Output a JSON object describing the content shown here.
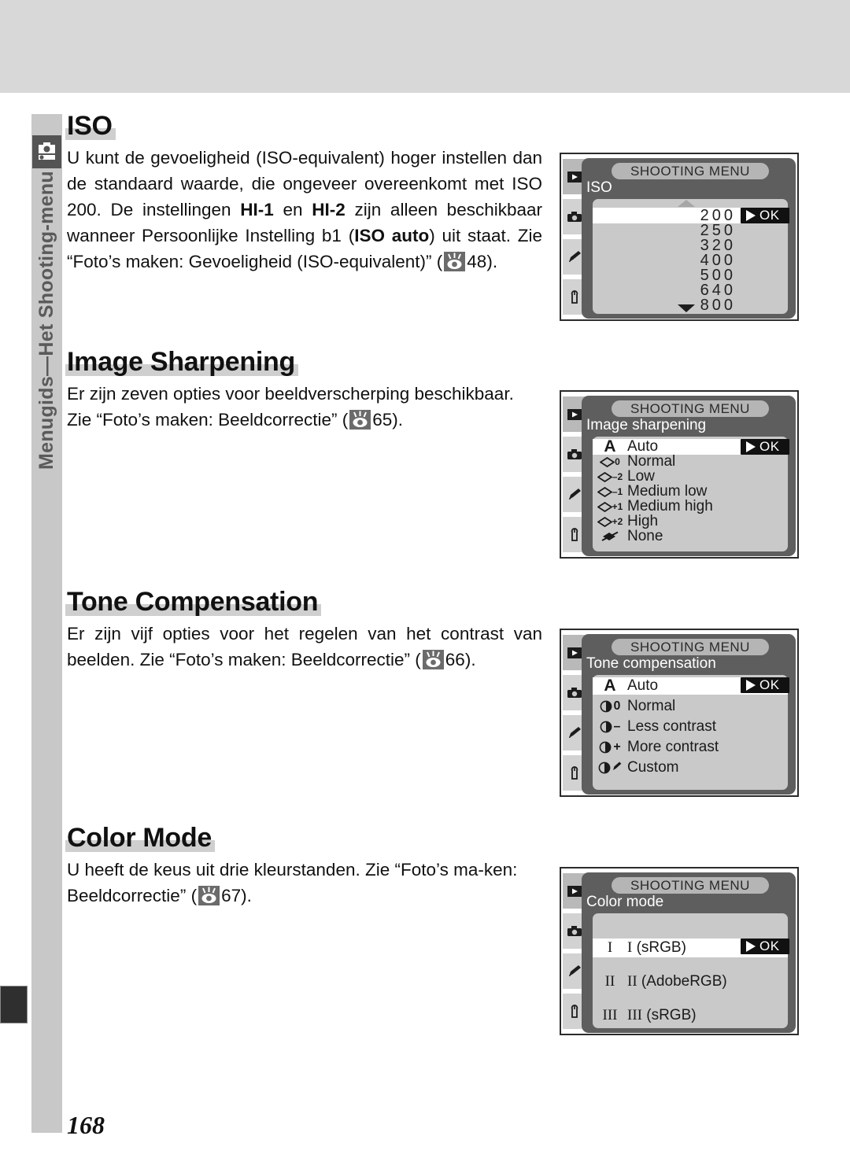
{
  "sidebar": {
    "label": "Menugids—Het Shooting-menu",
    "icon": "camera-icon"
  },
  "page_number": "168",
  "sections": [
    {
      "heading": "ISO",
      "body_runs": [
        {
          "t": "U kunt de gevoeligheid (ISO-equivalent) hoger instellen dan de standaard waarde, die ongeveer overeenkomt met ISO 200. De instellingen ",
          "b": false
        },
        {
          "t": "HI-1",
          "b": true
        },
        {
          "t": " en ",
          "b": false
        },
        {
          "t": "HI-2",
          "b": true
        },
        {
          "t": " zijn alleen beschikbaar wanneer Persoonlijke Instelling b1 (",
          "b": false
        },
        {
          "t": "ISO auto",
          "b": true
        },
        {
          "t": ") uit staat. Zie “Foto’s maken: Gevoeligheid (ISO-equivalent)” (",
          "b": false
        }
      ],
      "ref_page": "48).",
      "justify": true
    },
    {
      "heading": "Image Sharpening",
      "body_runs": [
        {
          "t": "Er zijn zeven opties voor beeldverscherping beschikbaar. Zie “Foto’s maken: Beeldcorrectie” (",
          "b": false
        }
      ],
      "ref_page": "65).",
      "justify": false
    },
    {
      "heading": "Tone Compensation",
      "body_runs": [
        {
          "t": "Er zijn vijf opties voor het regelen van het contrast van beelden. Zie “Foto’s maken: Beeldcorrectie” (",
          "b": false
        }
      ],
      "ref_page": "66).",
      "justify": true
    },
    {
      "heading": "Color Mode",
      "body_runs": [
        {
          "t": "U heeft de keus uit drie kleurstanden. Zie “Foto’s ma-ken: Beeldcorrectie” (",
          "b": false
        }
      ],
      "ref_page": "67).",
      "justify": false
    }
  ],
  "lcd_common": {
    "title": "SHOOTING MENU",
    "ok_label": "OK",
    "tabs": [
      {
        "name": "playback-tab",
        "selected": true
      },
      {
        "name": "shooting-tab",
        "selected": false
      },
      {
        "name": "custom-tab",
        "selected": false
      },
      {
        "name": "setup-tab",
        "selected": false
      }
    ]
  },
  "lcd_screens": [
    {
      "submenu": "ISO",
      "kind": "iso",
      "scroll_up": true,
      "scroll_down": true,
      "items": [
        {
          "value": "200",
          "selected": true
        },
        {
          "value": "250",
          "selected": false
        },
        {
          "value": "320",
          "selected": false
        },
        {
          "value": "400",
          "selected": false
        },
        {
          "value": "500",
          "selected": false
        },
        {
          "value": "640",
          "selected": false
        },
        {
          "value": "800",
          "selected": false
        }
      ]
    },
    {
      "submenu": "Image sharpening",
      "kind": "sharpening",
      "items": [
        {
          "icon": "A",
          "sup": "",
          "label": "Auto",
          "selected": true
        },
        {
          "icon": "diamond",
          "sup": "0",
          "label": "Normal",
          "selected": false
        },
        {
          "icon": "diamond",
          "sup": "–2",
          "label": "Low",
          "selected": false
        },
        {
          "icon": "diamond",
          "sup": "–1",
          "label": "Medium low",
          "selected": false
        },
        {
          "icon": "diamond",
          "sup": "+1",
          "label": "Medium high",
          "selected": false
        },
        {
          "icon": "diamond",
          "sup": "+2",
          "label": "High",
          "selected": false
        },
        {
          "icon": "diamond-slash",
          "sup": "",
          "label": "None",
          "selected": false
        }
      ]
    },
    {
      "submenu": "Tone compensation",
      "kind": "tone",
      "items": [
        {
          "icon": "A",
          "sup": "",
          "label": "Auto",
          "selected": true
        },
        {
          "icon": "halfcircle",
          "sup": "0",
          "label": "Normal",
          "selected": false
        },
        {
          "icon": "halfcircle",
          "sup": "–",
          "label": "Less contrast",
          "selected": false
        },
        {
          "icon": "halfcircle",
          "sup": "+",
          "label": "More contrast",
          "selected": false
        },
        {
          "icon": "halfcircle",
          "sup": "pencil",
          "label": "Custom",
          "selected": false
        }
      ]
    },
    {
      "submenu": "Color mode",
      "kind": "color",
      "items": [
        {
          "icon": "I",
          "label_num": "I",
          "label_rest": "(sRGB)",
          "selected": true
        },
        {
          "icon": "II",
          "label_num": "II",
          "label_rest": "(AdobeRGB)",
          "selected": false
        },
        {
          "icon": "III",
          "label_num": "III",
          "label_rest": "(sRGB)",
          "selected": false
        }
      ]
    }
  ]
}
